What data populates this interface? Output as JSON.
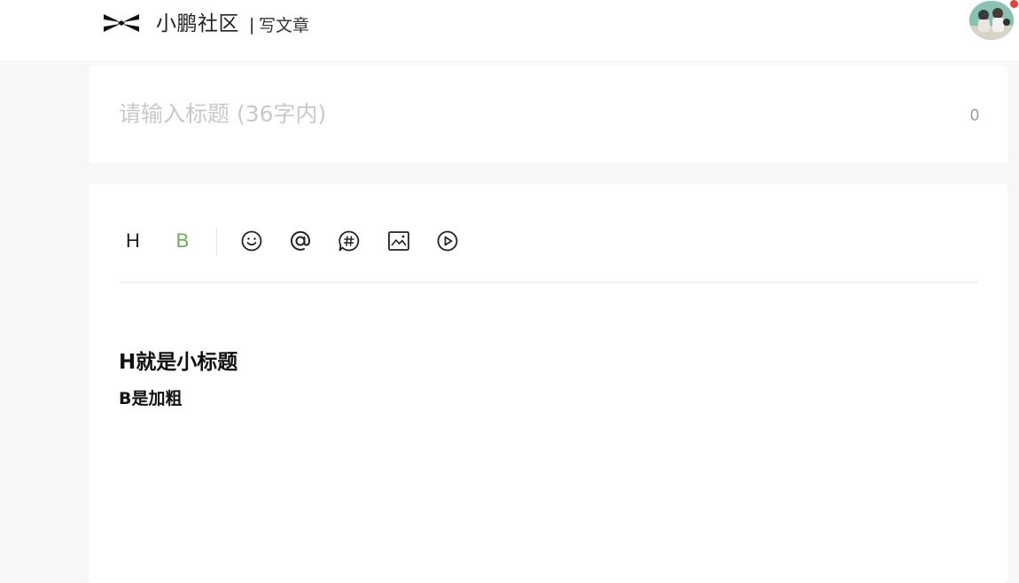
{
  "header": {
    "brand": "小鹏社区",
    "separator": "|",
    "page_name": "写文章",
    "logo_icon": "xpeng-logo-icon",
    "avatar_icon": "user-avatar",
    "notification_color": "#ee3b3b"
  },
  "title_card": {
    "placeholder": "请输入标题 (36字内)",
    "value": "",
    "char_count": "0"
  },
  "toolbar": {
    "heading_label": "H",
    "bold_label": "B",
    "bold_color": "#6ab04c",
    "icons": [
      "emoji-icon",
      "mention-icon",
      "topic-icon",
      "image-icon",
      "video-icon"
    ]
  },
  "editor": {
    "heading_text": "H就是小标题",
    "bold_text": "B是加粗"
  }
}
